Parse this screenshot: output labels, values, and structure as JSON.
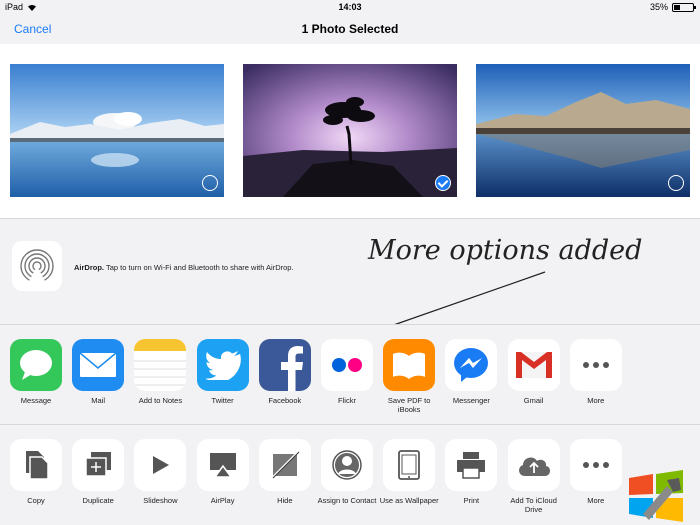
{
  "status": {
    "device": "iPad",
    "time": "14:03",
    "battery": "35%",
    "battery_level": 0.35
  },
  "nav": {
    "cancel": "Cancel",
    "title": "1 Photo Selected"
  },
  "airdrop": {
    "title": "AirDrop.",
    "text": " Tap to turn on Wi-Fi and Bluetooth to share with AirDrop."
  },
  "annotation": "More options added",
  "apps": [
    {
      "label": "Message",
      "icon": "message-icon",
      "color": "#34c759"
    },
    {
      "label": "Mail",
      "icon": "mail-icon",
      "color": "#1e8cf0"
    },
    {
      "label": "Add to Notes",
      "icon": "notes-icon",
      "color": "#ffffff"
    },
    {
      "label": "Twitter",
      "icon": "twitter-icon",
      "color": "#1da1f2"
    },
    {
      "label": "Facebook",
      "icon": "facebook-icon",
      "color": "#3b5998"
    },
    {
      "label": "Flickr",
      "icon": "flickr-icon",
      "color": "#ffffff"
    },
    {
      "label": "Save PDF to iBooks",
      "icon": "ibooks-icon",
      "color": "#ff8a00"
    },
    {
      "label": "Messenger",
      "icon": "messenger-icon",
      "color": "#ffffff"
    },
    {
      "label": "Gmail",
      "icon": "gmail-icon",
      "color": "#ffffff"
    },
    {
      "label": "More",
      "icon": "more-icon",
      "color": "#ffffff"
    }
  ],
  "actions": [
    {
      "label": "Copy",
      "icon": "copy-icon"
    },
    {
      "label": "Duplicate",
      "icon": "duplicate-icon"
    },
    {
      "label": "Slideshow",
      "icon": "slideshow-icon"
    },
    {
      "label": "AirPlay",
      "icon": "airplay-icon"
    },
    {
      "label": "Hide",
      "icon": "hide-icon"
    },
    {
      "label": "Assign to Contact",
      "icon": "contact-icon"
    },
    {
      "label": "Use as Wallpaper",
      "icon": "wallpaper-icon"
    },
    {
      "label": "Print",
      "icon": "print-icon"
    },
    {
      "label": "Add To iCloud Drive",
      "icon": "icloud-icon"
    },
    {
      "label": "More",
      "icon": "more-icon"
    }
  ]
}
